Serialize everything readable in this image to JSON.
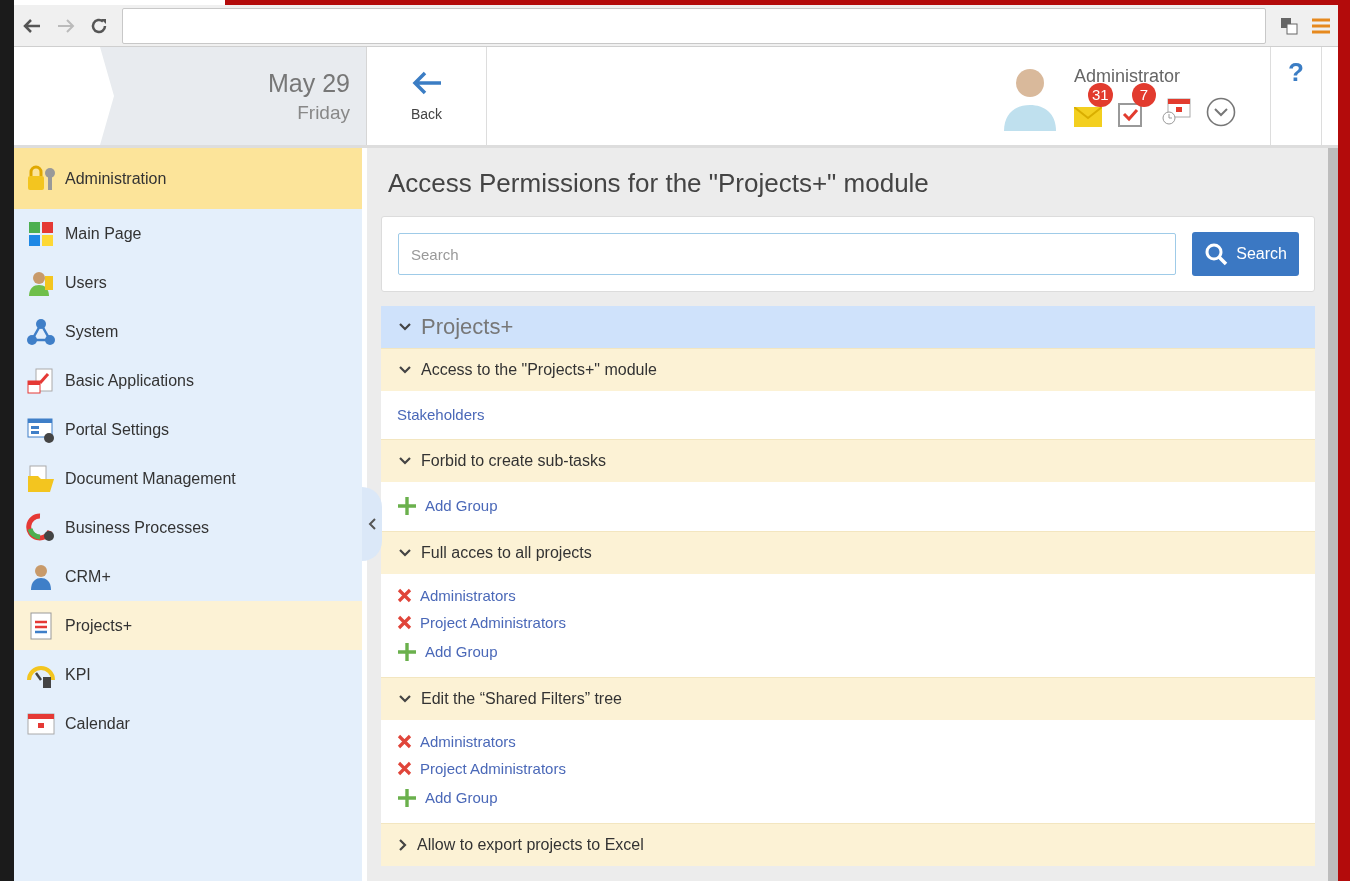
{
  "header": {
    "date": "May 29",
    "weekday": "Friday",
    "back_label": "Back",
    "user_name": "Administrator",
    "mail_count": "31",
    "task_count": "7",
    "help": "?"
  },
  "sidebar": {
    "items": [
      {
        "label": "Administration",
        "selected": true
      },
      {
        "label": "Main Page",
        "selected": false
      },
      {
        "label": "Users",
        "selected": false
      },
      {
        "label": "System",
        "selected": false
      },
      {
        "label": "Basic Applications",
        "selected": false
      },
      {
        "label": "Portal Settings",
        "selected": false
      },
      {
        "label": "Document Management",
        "selected": false
      },
      {
        "label": "Business Processes",
        "selected": false
      },
      {
        "label": "CRM+",
        "selected": false
      },
      {
        "label": "Projects+",
        "selected": true
      },
      {
        "label": "KPI",
        "selected": false
      },
      {
        "label": "Calendar",
        "selected": false
      }
    ]
  },
  "page_title": "Access Permissions for the \"Projects+\" module",
  "search": {
    "placeholder": "Search",
    "button": "Search"
  },
  "module": {
    "title": "Projects+",
    "expanded": true,
    "sections": [
      {
        "title": "Access to the \"Projects+\" module",
        "expanded": true,
        "entries": [
          {
            "kind": "plain",
            "label": "Stakeholders"
          }
        ]
      },
      {
        "title": "Forbid to create sub-tasks",
        "expanded": true,
        "entries": [
          {
            "kind": "add",
            "label": "Add Group"
          }
        ]
      },
      {
        "title": "Full acces to all projects",
        "expanded": true,
        "entries": [
          {
            "kind": "member",
            "label": "Administrators"
          },
          {
            "kind": "member",
            "label": "Project Administrators"
          },
          {
            "kind": "add",
            "label": "Add Group"
          }
        ]
      },
      {
        "title": "Edit the “Shared Filters” tree",
        "expanded": true,
        "entries": [
          {
            "kind": "member",
            "label": "Administrators"
          },
          {
            "kind": "member",
            "label": "Project Administrators"
          },
          {
            "kind": "add",
            "label": "Add Group"
          }
        ]
      },
      {
        "title": "Allow to export projects to Excel",
        "expanded": false
      }
    ]
  }
}
